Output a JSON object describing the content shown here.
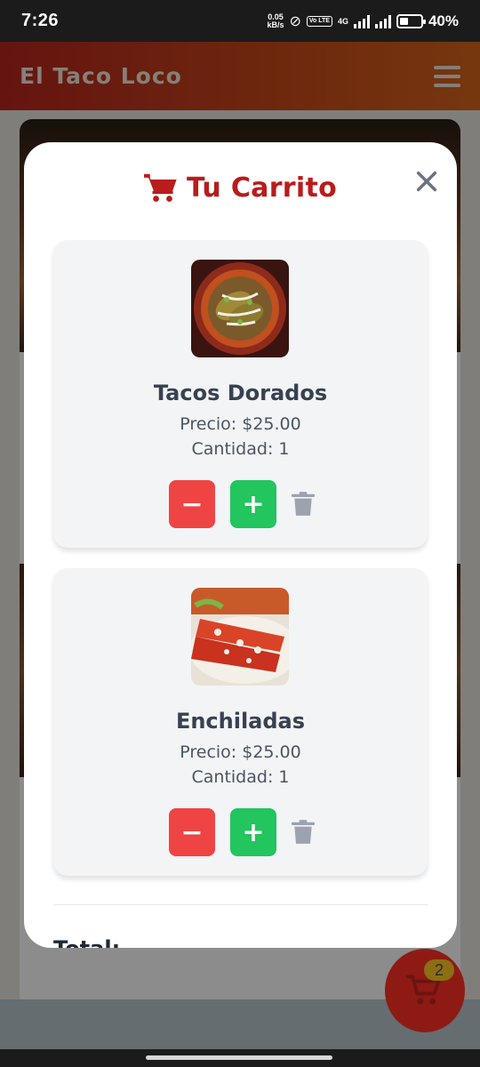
{
  "status": {
    "time": "7:26",
    "speed_value": "0.05",
    "speed_unit": "kB/s",
    "volte": "Vo LTE",
    "network": "4G",
    "battery": "40%",
    "battery_level": 0.4
  },
  "header": {
    "title": "El Taco Loco"
  },
  "cart_fab": {
    "count": "2"
  },
  "modal": {
    "title": "Tu Carrito",
    "items": [
      {
        "name": "Tacos Dorados",
        "price": "Precio: $25.00",
        "qty": "Cantidad: 1",
        "minus": "−",
        "plus": "+"
      },
      {
        "name": "Enchiladas",
        "price": "Precio: $25.00",
        "qty": "Cantidad: 1",
        "minus": "−",
        "plus": "+"
      }
    ],
    "total_label": "Total:"
  },
  "colors": {
    "accent": "#b91c1c",
    "minus": "#ef4444",
    "plus": "#22c55e",
    "card_bg": "#f3f4f6"
  },
  "icons": [
    "cart-icon",
    "close-icon",
    "trash-icon",
    "menu-icon"
  ]
}
